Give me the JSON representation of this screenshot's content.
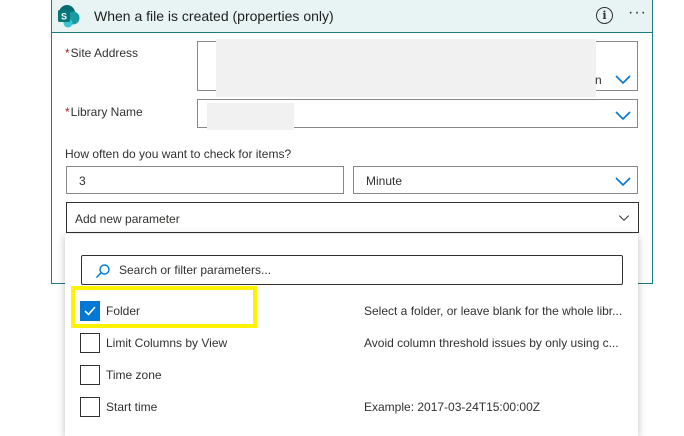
{
  "trigger": {
    "title": "When a file is created (properties only)",
    "site_address_label": "Site Address",
    "site_address_value_tail": "n",
    "library_name_label": "Library Name",
    "frequency_question": "How often do you want to check for items?",
    "interval_value": "3",
    "frequency_value": "Minute",
    "add_parameter_label": "Add new parameter",
    "required_mark": "*"
  },
  "parameter_dropdown": {
    "search_placeholder": "Search or filter parameters...",
    "options": [
      {
        "label": "Folder",
        "description": "Select a folder, or leave blank for the whole libr...",
        "checked": true
      },
      {
        "label": "Limit Columns by View",
        "description": "Avoid column threshold issues by only using c...",
        "checked": false
      },
      {
        "label": "Time zone",
        "description": "",
        "checked": false
      },
      {
        "label": "Start time",
        "description": "Example: 2017-03-24T15:00:00Z",
        "checked": false
      }
    ]
  },
  "icons": {
    "logo": "sharepoint-logo-icon",
    "info": "info-icon",
    "more": "more-options-icon",
    "chevron": "chevron-down-icon",
    "search": "search-icon",
    "check": "checkmark-icon"
  },
  "colors": {
    "header_bg": "#e8f3f4",
    "card_border": "#1e7b83",
    "accent_blue": "#0078d4",
    "required_red": "#a4262c",
    "highlight_yellow": "#fff200"
  }
}
